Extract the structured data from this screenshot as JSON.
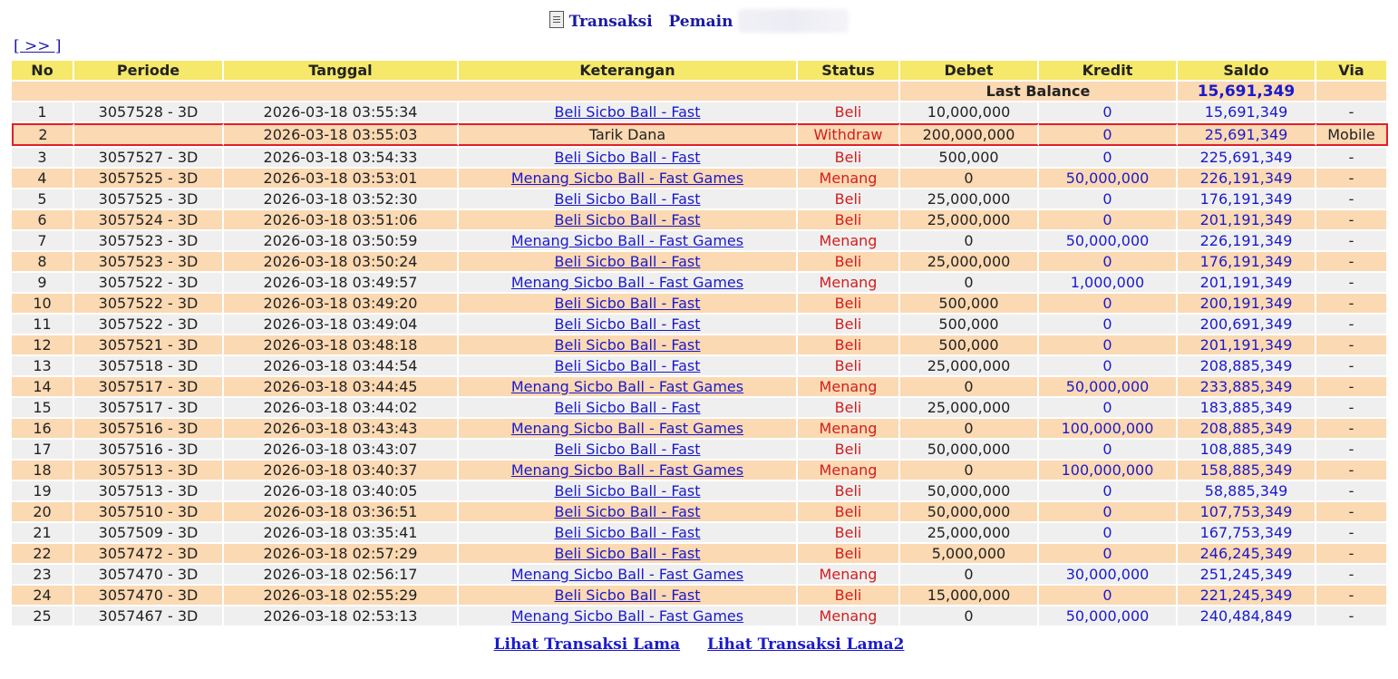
{
  "header": {
    "title_part1": "Transaksi",
    "title_part2": "Pemain"
  },
  "nav": {
    "next_link": "[ >> ]"
  },
  "table": {
    "columns": [
      "No",
      "Periode",
      "Tanggal",
      "Keterangan",
      "Status",
      "Debet",
      "Kredit",
      "Saldo",
      "Via"
    ],
    "last_balance_label": "Last Balance",
    "last_balance_value": "15,691,349",
    "rows": [
      {
        "no": "1",
        "periode": "3057528 - 3D",
        "tanggal": "2026-03-18 03:55:34",
        "keterangan": "Beli Sicbo Ball - Fast",
        "link": true,
        "status": "Beli",
        "debet": "10,000,000",
        "kredit": "0",
        "saldo": "15,691,349",
        "via": "-"
      },
      {
        "no": "2",
        "periode": "",
        "tanggal": "2026-03-18 03:55:03",
        "keterangan": "Tarik Dana",
        "link": false,
        "status": "Withdraw",
        "debet": "200,000,000",
        "kredit": "0",
        "saldo": "25,691,349",
        "via": "Mobile"
      },
      {
        "no": "3",
        "periode": "3057527 - 3D",
        "tanggal": "2026-03-18 03:54:33",
        "keterangan": "Beli Sicbo Ball - Fast",
        "link": true,
        "status": "Beli",
        "debet": "500,000",
        "kredit": "0",
        "saldo": "225,691,349",
        "via": "-"
      },
      {
        "no": "4",
        "periode": "3057525 - 3D",
        "tanggal": "2026-03-18 03:53:01",
        "keterangan": "Menang Sicbo Ball - Fast Games",
        "link": true,
        "status": "Menang",
        "debet": "0",
        "kredit": "50,000,000",
        "saldo": "226,191,349",
        "via": "-"
      },
      {
        "no": "5",
        "periode": "3057525 - 3D",
        "tanggal": "2026-03-18 03:52:30",
        "keterangan": "Beli Sicbo Ball - Fast",
        "link": true,
        "status": "Beli",
        "debet": "25,000,000",
        "kredit": "0",
        "saldo": "176,191,349",
        "via": "-"
      },
      {
        "no": "6",
        "periode": "3057524 - 3D",
        "tanggal": "2026-03-18 03:51:06",
        "keterangan": "Beli Sicbo Ball - Fast",
        "link": true,
        "status": "Beli",
        "debet": "25,000,000",
        "kredit": "0",
        "saldo": "201,191,349",
        "via": "-"
      },
      {
        "no": "7",
        "periode": "3057523 - 3D",
        "tanggal": "2026-03-18 03:50:59",
        "keterangan": "Menang Sicbo Ball - Fast Games",
        "link": true,
        "status": "Menang",
        "debet": "0",
        "kredit": "50,000,000",
        "saldo": "226,191,349",
        "via": "-"
      },
      {
        "no": "8",
        "periode": "3057523 - 3D",
        "tanggal": "2026-03-18 03:50:24",
        "keterangan": "Beli Sicbo Ball - Fast",
        "link": true,
        "status": "Beli",
        "debet": "25,000,000",
        "kredit": "0",
        "saldo": "176,191,349",
        "via": "-"
      },
      {
        "no": "9",
        "periode": "3057522 - 3D",
        "tanggal": "2026-03-18 03:49:57",
        "keterangan": "Menang Sicbo Ball - Fast Games",
        "link": true,
        "status": "Menang",
        "debet": "0",
        "kredit": "1,000,000",
        "saldo": "201,191,349",
        "via": "-"
      },
      {
        "no": "10",
        "periode": "3057522 - 3D",
        "tanggal": "2026-03-18 03:49:20",
        "keterangan": "Beli Sicbo Ball - Fast",
        "link": true,
        "status": "Beli",
        "debet": "500,000",
        "kredit": "0",
        "saldo": "200,191,349",
        "via": "-"
      },
      {
        "no": "11",
        "periode": "3057522 - 3D",
        "tanggal": "2026-03-18 03:49:04",
        "keterangan": "Beli Sicbo Ball - Fast",
        "link": true,
        "status": "Beli",
        "debet": "500,000",
        "kredit": "0",
        "saldo": "200,691,349",
        "via": "-"
      },
      {
        "no": "12",
        "periode": "3057521 - 3D",
        "tanggal": "2026-03-18 03:48:18",
        "keterangan": "Beli Sicbo Ball - Fast",
        "link": true,
        "status": "Beli",
        "debet": "500,000",
        "kredit": "0",
        "saldo": "201,191,349",
        "via": "-"
      },
      {
        "no": "13",
        "periode": "3057518 - 3D",
        "tanggal": "2026-03-18 03:44:54",
        "keterangan": "Beli Sicbo Ball - Fast",
        "link": true,
        "status": "Beli",
        "debet": "25,000,000",
        "kredit": "0",
        "saldo": "208,885,349",
        "via": "-"
      },
      {
        "no": "14",
        "periode": "3057517 - 3D",
        "tanggal": "2026-03-18 03:44:45",
        "keterangan": "Menang Sicbo Ball - Fast Games",
        "link": true,
        "status": "Menang",
        "debet": "0",
        "kredit": "50,000,000",
        "saldo": "233,885,349",
        "via": "-"
      },
      {
        "no": "15",
        "periode": "3057517 - 3D",
        "tanggal": "2026-03-18 03:44:02",
        "keterangan": "Beli Sicbo Ball - Fast",
        "link": true,
        "status": "Beli",
        "debet": "25,000,000",
        "kredit": "0",
        "saldo": "183,885,349",
        "via": "-"
      },
      {
        "no": "16",
        "periode": "3057516 - 3D",
        "tanggal": "2026-03-18 03:43:43",
        "keterangan": "Menang Sicbo Ball - Fast Games",
        "link": true,
        "status": "Menang",
        "debet": "0",
        "kredit": "100,000,000",
        "saldo": "208,885,349",
        "via": "-"
      },
      {
        "no": "17",
        "periode": "3057516 - 3D",
        "tanggal": "2026-03-18 03:43:07",
        "keterangan": "Beli Sicbo Ball - Fast",
        "link": true,
        "status": "Beli",
        "debet": "50,000,000",
        "kredit": "0",
        "saldo": "108,885,349",
        "via": "-"
      },
      {
        "no": "18",
        "periode": "3057513 - 3D",
        "tanggal": "2026-03-18 03:40:37",
        "keterangan": "Menang Sicbo Ball - Fast Games",
        "link": true,
        "status": "Menang",
        "debet": "0",
        "kredit": "100,000,000",
        "saldo": "158,885,349",
        "via": "-"
      },
      {
        "no": "19",
        "periode": "3057513 - 3D",
        "tanggal": "2026-03-18 03:40:05",
        "keterangan": "Beli Sicbo Ball - Fast",
        "link": true,
        "status": "Beli",
        "debet": "50,000,000",
        "kredit": "0",
        "saldo": "58,885,349",
        "via": "-"
      },
      {
        "no": "20",
        "periode": "3057510 - 3D",
        "tanggal": "2026-03-18 03:36:51",
        "keterangan": "Beli Sicbo Ball - Fast",
        "link": true,
        "status": "Beli",
        "debet": "50,000,000",
        "kredit": "0",
        "saldo": "107,753,349",
        "via": "-"
      },
      {
        "no": "21",
        "periode": "3057509 - 3D",
        "tanggal": "2026-03-18 03:35:41",
        "keterangan": "Beli Sicbo Ball - Fast",
        "link": true,
        "status": "Beli",
        "debet": "25,000,000",
        "kredit": "0",
        "saldo": "167,753,349",
        "via": "-"
      },
      {
        "no": "22",
        "periode": "3057472 - 3D",
        "tanggal": "2026-03-18 02:57:29",
        "keterangan": "Beli Sicbo Ball - Fast",
        "link": true,
        "status": "Beli",
        "debet": "5,000,000",
        "kredit": "0",
        "saldo": "246,245,349",
        "via": "-"
      },
      {
        "no": "23",
        "periode": "3057470 - 3D",
        "tanggal": "2026-03-18 02:56:17",
        "keterangan": "Menang Sicbo Ball - Fast Games",
        "link": true,
        "status": "Menang",
        "debet": "0",
        "kredit": "30,000,000",
        "saldo": "251,245,349",
        "via": "-"
      },
      {
        "no": "24",
        "periode": "3057470 - 3D",
        "tanggal": "2026-03-18 02:55:29",
        "keterangan": "Beli Sicbo Ball - Fast",
        "link": true,
        "status": "Beli",
        "debet": "15,000,000",
        "kredit": "0",
        "saldo": "221,245,349",
        "via": "-"
      },
      {
        "no": "25",
        "periode": "3057467 - 3D",
        "tanggal": "2026-03-18 02:53:13",
        "keterangan": "Menang Sicbo Ball - Fast Games",
        "link": true,
        "status": "Menang",
        "debet": "0",
        "kredit": "50,000,000",
        "saldo": "240,484,849",
        "via": "-"
      }
    ]
  },
  "footer": {
    "link1": "Lihat Transaksi Lama",
    "link2": "Lihat Transaksi Lama2"
  },
  "colors": {
    "header_bg": "#f5e86a",
    "row_orange": "#fbd9b2",
    "row_gray": "#efefef",
    "link_blue": "#1a1acc",
    "status_red": "#d11e1e",
    "highlight_border": "#e0202a"
  }
}
